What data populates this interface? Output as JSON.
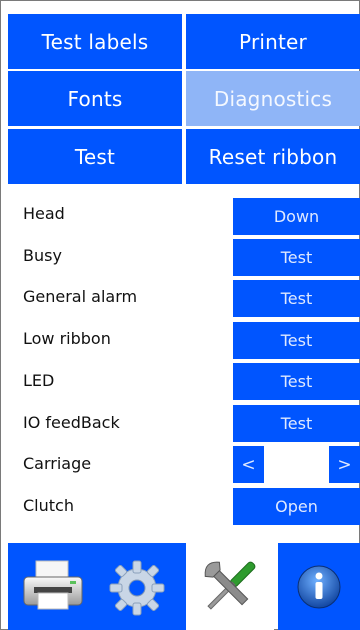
{
  "tabs": [
    {
      "label": "Test labels",
      "active": false
    },
    {
      "label": "Printer",
      "active": false
    },
    {
      "label": "Fonts",
      "active": false
    },
    {
      "label": "Diagnostics",
      "active": true
    },
    {
      "label": "Test",
      "active": false
    },
    {
      "label": "Reset ribbon",
      "active": false
    }
  ],
  "rows": [
    {
      "label": "Head",
      "button": "Down"
    },
    {
      "label": "Busy",
      "button": "Test"
    },
    {
      "label": "General alarm",
      "button": "Test"
    },
    {
      "label": "Low ribbon",
      "button": "Test"
    },
    {
      "label": "LED",
      "button": "Test"
    },
    {
      "label": "IO feedBack",
      "button": "Test"
    },
    {
      "label": "Carriage",
      "stepper": {
        "left": "<",
        "value": "",
        "right": ">"
      }
    },
    {
      "label": "Clutch",
      "button": "Open"
    }
  ],
  "toolbar": {
    "items": [
      "printer-icon",
      "gear-icon",
      "tools-icon",
      "info-icon"
    ],
    "active": "tools-icon"
  },
  "colors": {
    "accent": "#0055ff",
    "active_tab": "#8fb5f7",
    "button_text": "#dfe9ff"
  }
}
